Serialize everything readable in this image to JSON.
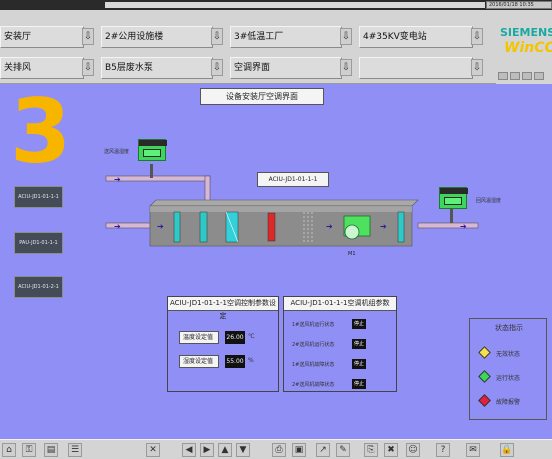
{
  "header": {
    "clock": "2016/01/18 10:35"
  },
  "nav": {
    "row1": [
      {
        "label": "安装厅"
      },
      {
        "label": "2#公用设施楼"
      },
      {
        "label": "3#低温工厂"
      },
      {
        "label": "4#35KV变电站"
      }
    ],
    "row2": [
      {
        "label": "关排风"
      },
      {
        "label": "B5层废水泵"
      },
      {
        "label": "空调界面"
      },
      {
        "label": ""
      }
    ],
    "arrow": "⇩"
  },
  "logo": {
    "brand": "SIEMENS",
    "product": "WinCC"
  },
  "main": {
    "area_number": "3",
    "title": "设备安装厅空调界面",
    "unit_label": "ACIU-JD1-01-1-1",
    "left_buttons": [
      "ACIU-JD1-01-1-1",
      "PAU-JD1-01-1-1",
      "ACIU-JD1-01-2-1"
    ],
    "inlet_label": "送风温湿度",
    "outlet_label": "回风温湿度",
    "fan_tag": "M1",
    "arrow_glyph": "➔"
  },
  "setpoints": {
    "header": "ACIU-JD1-01-1-1空调控制参数设定",
    "temp_label": "温度设定值",
    "temp_value": "26.00",
    "temp_unit": "℃",
    "hum_label": "湿度设定值",
    "hum_value": "55.00",
    "hum_unit": "%"
  },
  "status": {
    "header": "ACIU-JD1-01-1-1空调机组参数",
    "rows": [
      {
        "label": "1#送风机运行状态",
        "value": "停止"
      },
      {
        "label": "2#送风机运行状态",
        "value": "停止"
      },
      {
        "label": "1#送风机故障状态",
        "value": "停止"
      },
      {
        "label": "2#送风机故障状态",
        "value": "停止"
      }
    ]
  },
  "legend": {
    "title": "状态指示",
    "items": [
      {
        "label": "无效状态",
        "color": "#f4e04a"
      },
      {
        "label": "运行状态",
        "color": "#3ed65a"
      },
      {
        "label": "故障报警",
        "color": "#e0233a"
      }
    ]
  },
  "toolbar": {
    "icons": [
      "home-icon",
      "key-icon",
      "report-icon",
      "alarm-list-icon",
      "exit-icon",
      "back-icon",
      "forward-icon",
      "up-icon",
      "down-icon",
      "print-icon",
      "save-icon",
      "trend-icon",
      "edit-icon",
      "copy-icon",
      "delete-icon",
      "user-icon",
      "help-icon",
      "log-icon",
      "lock-icon"
    ],
    "glyphs": [
      "⌂",
      "⚿",
      "▤",
      "☰",
      "✕",
      "◀",
      "▶",
      "▲",
      "▼",
      "⎙",
      "▣",
      "↗",
      "✎",
      "⎘",
      "✖",
      "☺",
      "?",
      "✉",
      "🔒"
    ]
  }
}
